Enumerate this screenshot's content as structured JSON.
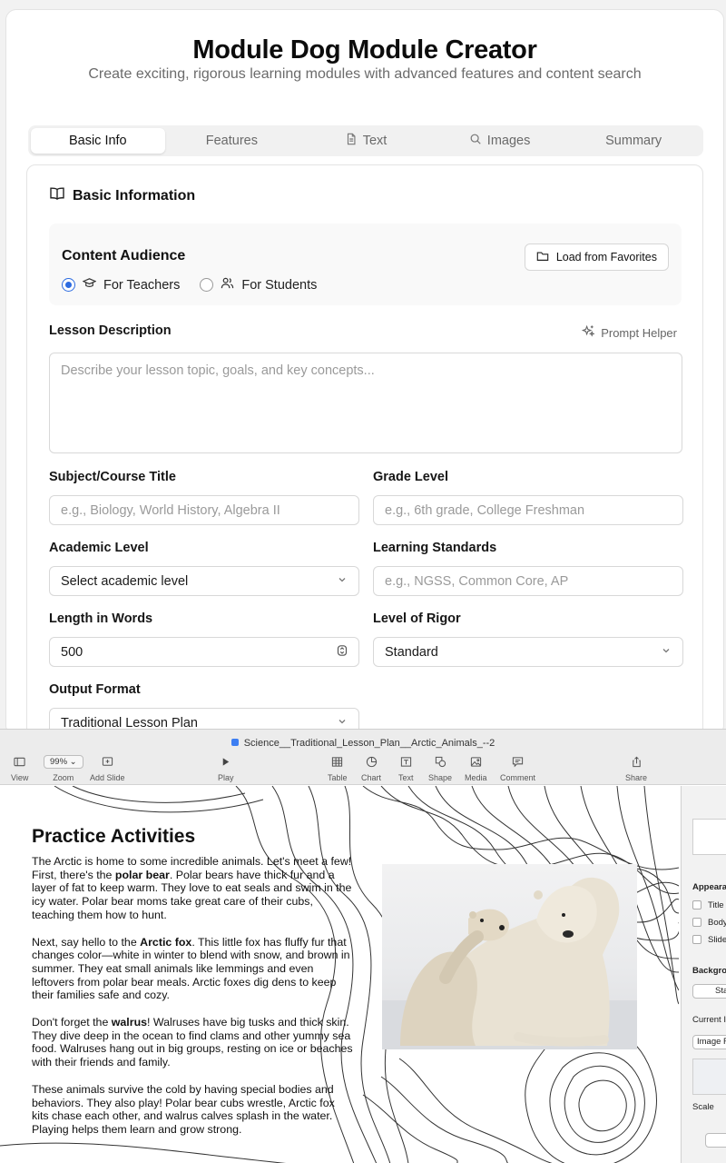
{
  "app": {
    "title": "Module Dog Module Creator",
    "subtitle": "Create exciting, rigorous learning modules with advanced features and content search"
  },
  "tabs": [
    {
      "label": "Basic Info",
      "icon": "",
      "active": true
    },
    {
      "label": "Features",
      "icon": ""
    },
    {
      "label": "Text",
      "icon": "document-icon"
    },
    {
      "label": "Images",
      "icon": "search-icon"
    },
    {
      "label": "Summary",
      "icon": ""
    }
  ],
  "basic_info": {
    "section_title": "Basic Information",
    "section_icon": "book-icon",
    "audience": {
      "title": "Content Audience",
      "load_favorites_label": "Load from Favorites",
      "options": [
        {
          "label": "For Teachers",
          "icon": "graduation-cap-icon",
          "selected": true
        },
        {
          "label": "For Students",
          "icon": "users-icon",
          "selected": false
        }
      ]
    },
    "lesson_description": {
      "label": "Lesson Description",
      "prompt_helper_label": "Prompt Helper",
      "placeholder": "Describe your lesson topic, goals, and key concepts..."
    },
    "fields": {
      "subject": {
        "label": "Subject/Course Title",
        "placeholder": "e.g., Biology, World History, Algebra II"
      },
      "grade": {
        "label": "Grade Level",
        "placeholder": "e.g., 6th grade, College Freshman"
      },
      "academic_level": {
        "label": "Academic Level",
        "value": "Select academic level"
      },
      "standards": {
        "label": "Learning Standards",
        "placeholder": "e.g., NGSS, Common Core, AP"
      },
      "length": {
        "label": "Length in Words",
        "value": "500"
      },
      "rigor": {
        "label": "Level of Rigor",
        "value": "Standard"
      },
      "output_format": {
        "label": "Output Format",
        "value": "Traditional Lesson Plan"
      }
    }
  },
  "keynote": {
    "doc_title": "Science__Traditional_Lesson_Plan__Arctic_Animals_--2",
    "zoom": "99%",
    "toolbar": {
      "view": "View",
      "zoom": "Zoom",
      "add_slide": "Add Slide",
      "play": "Play",
      "table": "Table",
      "chart": "Chart",
      "text": "Text",
      "shape": "Shape",
      "media": "Media",
      "comment": "Comment",
      "share": "Share"
    },
    "slide": {
      "heading": "Practice Activities",
      "p1_a": "The Arctic is home to some incredible animals. Let's meet a few! First, there's the ",
      "p1_bold": "polar bear",
      "p1_b": ". Polar bears have thick fur and a layer of fat to keep warm. They love to eat seals and swim in the icy water. Polar bear moms take great care of their cubs, teaching them how to hunt.",
      "p2_a": "Next, say hello to the ",
      "p2_bold": "Arctic fox",
      "p2_b": ". This little fox has fluffy fur that changes color—white in winter to blend with snow, and brown in summer. They eat small animals like lemmings and even leftovers from polar bear meals. Arctic foxes dig dens to keep their families safe and cozy.",
      "p3_a": "Don't forget the ",
      "p3_bold": "walrus",
      "p3_b": "! Walruses have big tusks and thick skin. They dive deep in the ocean to find clams and other yummy sea food. Walruses hang out in big groups, resting on ice or beaches with their friends and family.",
      "p4": "These animals survive the cold by having special bodies and behaviors. They also play! Polar bear cubs wrestle, Arctic fox kits chase each other, and walrus calves splash in the water. Playing helps them learn and grow strong."
    },
    "inspector": {
      "appearance": "Appeara",
      "title": "Title",
      "body": "Body",
      "slide_number": "Slide",
      "background": "Backgro",
      "background_btn": "Sta",
      "current": "Current I",
      "image_btn": "Image F",
      "scale": "Scale"
    }
  }
}
